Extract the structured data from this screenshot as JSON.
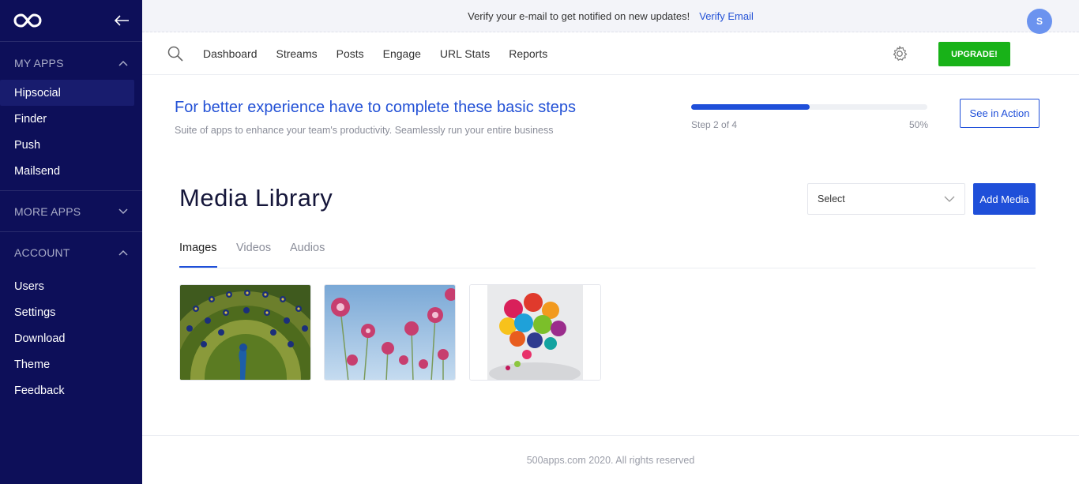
{
  "sidebar": {
    "logo_icon": "infinity-logo-icon",
    "collapse_icon": "arrow-left-icon",
    "my_apps": {
      "title": "MY APPS",
      "items": [
        "Hipsocial",
        "Finder",
        "Push",
        "Mailsend"
      ],
      "active": "Hipsocial"
    },
    "more_apps": {
      "title": "MORE APPS"
    },
    "account": {
      "title": "ACCOUNT",
      "items": [
        "Users",
        "Settings",
        "Download",
        "Theme",
        "Feedback"
      ]
    },
    "background": "#0d0f59"
  },
  "verify": {
    "text": "Verify your e-mail to get notified on new updates!",
    "link": "Verify Email"
  },
  "topnav": {
    "links": [
      "Dashboard",
      "Streams",
      "Posts",
      "Engage",
      "URL Stats",
      "Reports"
    ],
    "upgrade_label": "UPGRADE!",
    "avatar_initial": "S"
  },
  "steps": {
    "title": "For better experience have to complete these basic steps",
    "subtitle": "Suite of apps to enhance your team's productivity. Seamlessly run your entire business",
    "step_text": "Step 2 of 4",
    "percent_text": "50%",
    "progress_fraction": 0.5,
    "action_label": "See in Action"
  },
  "media": {
    "title": "Media Library",
    "select_value": "Select",
    "add_label": "Add Media",
    "tabs": [
      "Images",
      "Videos",
      "Audios"
    ],
    "active_tab": "Images",
    "images": [
      "peacock-image",
      "pink-flowers-image",
      "social-icons-image"
    ]
  },
  "footer": {
    "text": "500apps.com 2020. All rights reserved"
  },
  "colors": {
    "primary": "#1f4fd9",
    "upgrade": "#18b218",
    "avatar": "#6b93ef"
  }
}
